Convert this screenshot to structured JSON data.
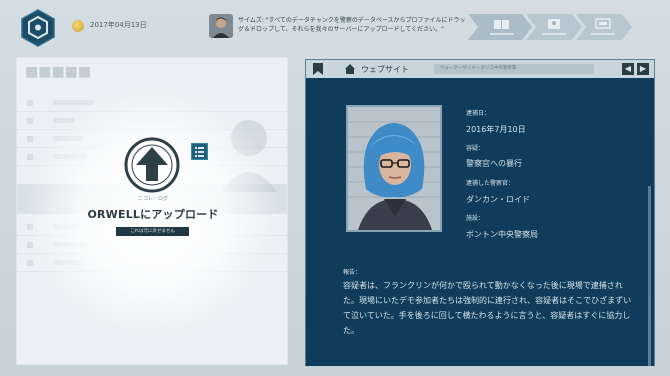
{
  "topbar": {
    "date": "2017年04月13日",
    "message": "サイムズ: \"すべてのデータチャンクを警察のデータベースからプロファイルにドラッグ＆ドロップして、それらを我々のサーバーにアップロードしてください。\""
  },
  "upload": {
    "caption": "ニコレ・ログ",
    "title": "ORWELLにアップロード",
    "button_label": "これは元に戻せません"
  },
  "browser": {
    "tab_label": "ウェブサイト",
    "url": "ウォーターサイド・ポリス中央警察署",
    "prev_label": "◀",
    "next_label": "▶"
  },
  "record": {
    "arrest_date_label": "逮捕日：",
    "arrest_date": "2016年7月10日",
    "charge_label": "容疑：",
    "charge": "警察官への暴行",
    "officer_label": "逮捕した警察官：",
    "officer": "ダンカン・ロイド",
    "facility_label": "施設：",
    "facility": "ボントン中央警察局",
    "report_label": "報告：",
    "report": "容疑者は、フランクリンが何かで殴られて動かなくなった後に現場で逮捕された。現場にいたデモ参加者たちは強制的に連行され、容疑者はそこでひざまずいて泣いていた。手を後ろに回して横たわるように言うと、容疑者はすぐに協力した。"
  },
  "colors": {
    "panel_dark": "#0f3c5a",
    "accent": "#1f5f7a",
    "background": "#cbd6dd"
  }
}
